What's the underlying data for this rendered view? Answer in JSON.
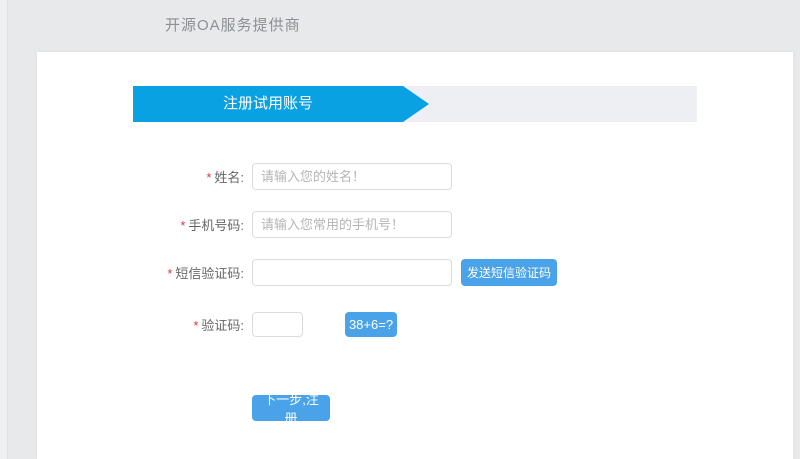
{
  "header": {
    "brand": "开源OA服务提供商"
  },
  "steps": {
    "active_label": "注册试用账号"
  },
  "form": {
    "required_marker": "*",
    "fields": [
      {
        "label": "姓名:",
        "placeholder": "请输入您的姓名！",
        "value": ""
      },
      {
        "label": "手机号码:",
        "placeholder": "请输入您常用的手机号！",
        "value": ""
      },
      {
        "label": "短信验证码:",
        "placeholder": "",
        "value": "",
        "button_label": "发送短信验证码"
      },
      {
        "label": "验证码:",
        "placeholder": "",
        "value": "",
        "captcha_label": "38+6=?"
      }
    ],
    "submit_label": "下一步,注册"
  },
  "colors": {
    "accent_blue": "#0aa1e2",
    "button_blue": "#4aa3e8",
    "required_red": "#d33c3c",
    "page_background": "#e8e9ea"
  }
}
